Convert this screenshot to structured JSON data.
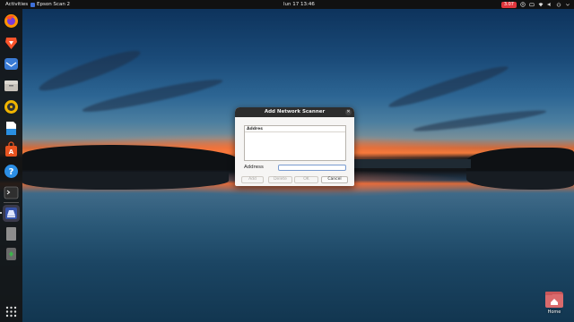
{
  "topbar": {
    "activities": "Activities",
    "app_name": "Epson Scan 2",
    "clock": "lun 17  13:46",
    "badge": "3.07"
  },
  "dock": {
    "items": [
      {
        "name": "firefox-icon",
        "color": "#ff7a1a"
      },
      {
        "name": "brave-icon",
        "color": "#fb542b"
      },
      {
        "name": "mail-icon",
        "color": "#3a7bd5"
      },
      {
        "name": "files-icon",
        "color": "#c7c2ba"
      },
      {
        "name": "rhythmbox-icon",
        "color": "#f0b400"
      },
      {
        "name": "writer-icon",
        "color": "#2a8fe0"
      },
      {
        "name": "software-icon",
        "color": "#e95420"
      },
      {
        "name": "help-icon",
        "color": "#2c8fe6"
      },
      {
        "name": "terminal-icon",
        "color": "#333333"
      },
      {
        "name": "scanner-icon",
        "color": "#3552a8"
      },
      {
        "name": "blank-app-icon",
        "color": "#8d8d8d"
      },
      {
        "name": "trash-icon",
        "color": "#6a6a6a"
      }
    ],
    "show_apps": "grid-icon"
  },
  "desktop": {
    "home_label": "Home"
  },
  "dialog": {
    "title": "Add Network Scanner",
    "list_header": "Addres",
    "address_label": "Address",
    "address_value": "",
    "buttons": {
      "add": "Add",
      "delete": "Delete",
      "ok": "OK",
      "cancel": "Cancel"
    }
  }
}
